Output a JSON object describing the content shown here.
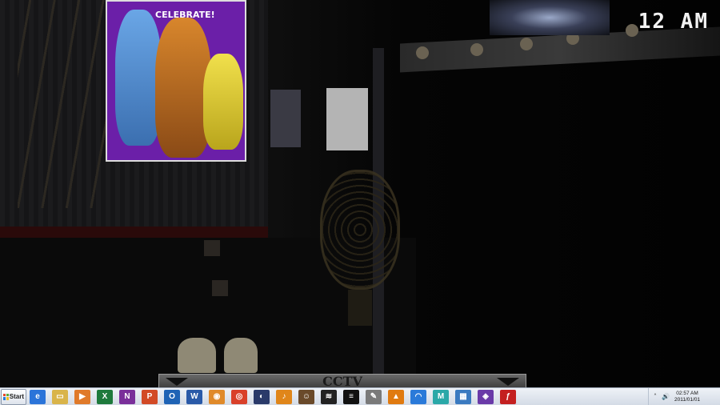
{
  "game": {
    "hour": "12 AM",
    "camera_bar": {
      "label": "CCTV"
    },
    "poster_title": "CELEBRATE!"
  },
  "taskbar": {
    "start_label": "Start",
    "apps": [
      {
        "name": "ie-icon",
        "glyph": "e",
        "color": "#2b74d9"
      },
      {
        "name": "file-explorer-icon",
        "glyph": "▭",
        "color": "#d9b44a"
      },
      {
        "name": "media-player-icon",
        "glyph": "▶",
        "color": "#e07a2a"
      },
      {
        "name": "excel-icon",
        "glyph": "X",
        "color": "#1e7a3c"
      },
      {
        "name": "onenote-icon",
        "glyph": "N",
        "color": "#7a2f9a"
      },
      {
        "name": "powerpoint-icon",
        "glyph": "P",
        "color": "#d24a26"
      },
      {
        "name": "outlook-icon",
        "glyph": "O",
        "color": "#1f63b5"
      },
      {
        "name": "word-icon",
        "glyph": "W",
        "color": "#2a5aa8"
      },
      {
        "name": "blender-icon",
        "glyph": "◉",
        "color": "#e08a2a"
      },
      {
        "name": "chrome-icon",
        "glyph": "◎",
        "color": "#d9402a"
      },
      {
        "name": "cinema4d-icon",
        "glyph": "◐",
        "color": "#2a3a6a"
      },
      {
        "name": "fl-studio-icon",
        "glyph": "♪",
        "color": "#e0861a"
      },
      {
        "name": "game-icon",
        "glyph": "☺",
        "color": "#6a4a2a"
      },
      {
        "name": "app-icon-1",
        "glyph": "≋",
        "color": "#222222"
      },
      {
        "name": "app-icon-2",
        "glyph": "≡",
        "color": "#111111"
      },
      {
        "name": "notepad-icon",
        "glyph": "✎",
        "color": "#7a7a7a"
      },
      {
        "name": "vlc-icon",
        "glyph": "▲",
        "color": "#e07a10"
      },
      {
        "name": "headphones-icon",
        "glyph": "◠",
        "color": "#2a7ad9"
      },
      {
        "name": "maya-icon",
        "glyph": "M",
        "color": "#2aa8a8"
      },
      {
        "name": "image-viewer-icon",
        "glyph": "▦",
        "color": "#3a7ac0"
      },
      {
        "name": "app-icon-3",
        "glyph": "◈",
        "color": "#6a3aa8"
      },
      {
        "name": "flash-icon",
        "glyph": "ƒ",
        "color": "#c42020"
      }
    ],
    "tray": {
      "time": "02:57 AM",
      "date": "2011/01/01",
      "chevron_glyph": "˄",
      "volume_glyph": "🔊"
    }
  }
}
